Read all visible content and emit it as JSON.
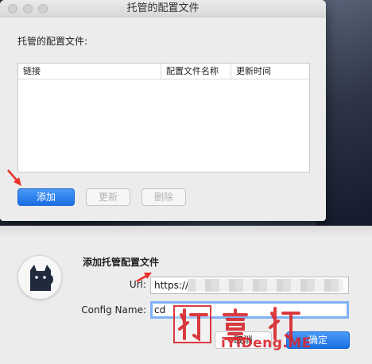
{
  "main_window": {
    "title": "托管的配置文件",
    "section_label": "托管的配置文件:",
    "table": {
      "columns": [
        "链接",
        "配置文件名称",
        "更新时间"
      ],
      "rows": []
    },
    "buttons": {
      "add": "添加",
      "update": "更新",
      "delete": "删除"
    }
  },
  "sheet": {
    "title": "添加托管配置文件",
    "url_label": "Url:",
    "url_value": "https://",
    "config_name_label": "Config Name:",
    "config_name_value": "cd",
    "cancel": "取消",
    "confirm": "确定"
  },
  "watermark": {
    "text": "灯 壹 灯",
    "url": "iYiDeng.ME"
  },
  "colors": {
    "accent": "#1a6fe3",
    "watermark": "#d8262c",
    "annotation_arrow": "#e8322a"
  }
}
